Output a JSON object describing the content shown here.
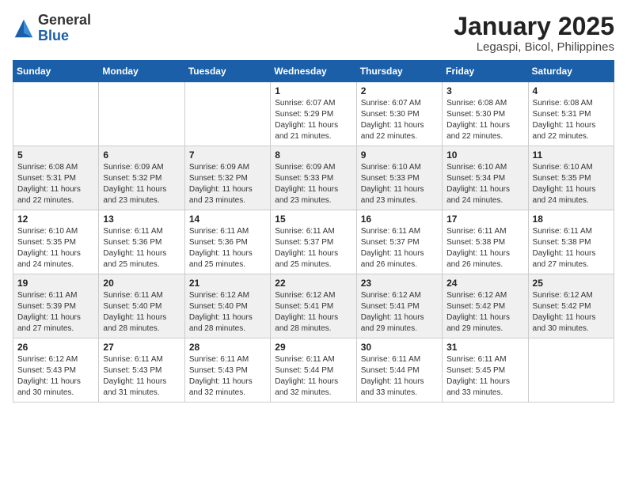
{
  "logo": {
    "text_general": "General",
    "text_blue": "Blue"
  },
  "title": "January 2025",
  "subtitle": "Legaspi, Bicol, Philippines",
  "days_of_week": [
    "Sunday",
    "Monday",
    "Tuesday",
    "Wednesday",
    "Thursday",
    "Friday",
    "Saturday"
  ],
  "weeks": [
    [
      {
        "day": "",
        "sunrise": "",
        "sunset": "",
        "daylight": ""
      },
      {
        "day": "",
        "sunrise": "",
        "sunset": "",
        "daylight": ""
      },
      {
        "day": "",
        "sunrise": "",
        "sunset": "",
        "daylight": ""
      },
      {
        "day": "1",
        "sunrise": "Sunrise: 6:07 AM",
        "sunset": "Sunset: 5:29 PM",
        "daylight": "Daylight: 11 hours and 21 minutes."
      },
      {
        "day": "2",
        "sunrise": "Sunrise: 6:07 AM",
        "sunset": "Sunset: 5:30 PM",
        "daylight": "Daylight: 11 hours and 22 minutes."
      },
      {
        "day": "3",
        "sunrise": "Sunrise: 6:08 AM",
        "sunset": "Sunset: 5:30 PM",
        "daylight": "Daylight: 11 hours and 22 minutes."
      },
      {
        "day": "4",
        "sunrise": "Sunrise: 6:08 AM",
        "sunset": "Sunset: 5:31 PM",
        "daylight": "Daylight: 11 hours and 22 minutes."
      }
    ],
    [
      {
        "day": "5",
        "sunrise": "Sunrise: 6:08 AM",
        "sunset": "Sunset: 5:31 PM",
        "daylight": "Daylight: 11 hours and 22 minutes."
      },
      {
        "day": "6",
        "sunrise": "Sunrise: 6:09 AM",
        "sunset": "Sunset: 5:32 PM",
        "daylight": "Daylight: 11 hours and 23 minutes."
      },
      {
        "day": "7",
        "sunrise": "Sunrise: 6:09 AM",
        "sunset": "Sunset: 5:32 PM",
        "daylight": "Daylight: 11 hours and 23 minutes."
      },
      {
        "day": "8",
        "sunrise": "Sunrise: 6:09 AM",
        "sunset": "Sunset: 5:33 PM",
        "daylight": "Daylight: 11 hours and 23 minutes."
      },
      {
        "day": "9",
        "sunrise": "Sunrise: 6:10 AM",
        "sunset": "Sunset: 5:33 PM",
        "daylight": "Daylight: 11 hours and 23 minutes."
      },
      {
        "day": "10",
        "sunrise": "Sunrise: 6:10 AM",
        "sunset": "Sunset: 5:34 PM",
        "daylight": "Daylight: 11 hours and 24 minutes."
      },
      {
        "day": "11",
        "sunrise": "Sunrise: 6:10 AM",
        "sunset": "Sunset: 5:35 PM",
        "daylight": "Daylight: 11 hours and 24 minutes."
      }
    ],
    [
      {
        "day": "12",
        "sunrise": "Sunrise: 6:10 AM",
        "sunset": "Sunset: 5:35 PM",
        "daylight": "Daylight: 11 hours and 24 minutes."
      },
      {
        "day": "13",
        "sunrise": "Sunrise: 6:11 AM",
        "sunset": "Sunset: 5:36 PM",
        "daylight": "Daylight: 11 hours and 25 minutes."
      },
      {
        "day": "14",
        "sunrise": "Sunrise: 6:11 AM",
        "sunset": "Sunset: 5:36 PM",
        "daylight": "Daylight: 11 hours and 25 minutes."
      },
      {
        "day": "15",
        "sunrise": "Sunrise: 6:11 AM",
        "sunset": "Sunset: 5:37 PM",
        "daylight": "Daylight: 11 hours and 25 minutes."
      },
      {
        "day": "16",
        "sunrise": "Sunrise: 6:11 AM",
        "sunset": "Sunset: 5:37 PM",
        "daylight": "Daylight: 11 hours and 26 minutes."
      },
      {
        "day": "17",
        "sunrise": "Sunrise: 6:11 AM",
        "sunset": "Sunset: 5:38 PM",
        "daylight": "Daylight: 11 hours and 26 minutes."
      },
      {
        "day": "18",
        "sunrise": "Sunrise: 6:11 AM",
        "sunset": "Sunset: 5:38 PM",
        "daylight": "Daylight: 11 hours and 27 minutes."
      }
    ],
    [
      {
        "day": "19",
        "sunrise": "Sunrise: 6:11 AM",
        "sunset": "Sunset: 5:39 PM",
        "daylight": "Daylight: 11 hours and 27 minutes."
      },
      {
        "day": "20",
        "sunrise": "Sunrise: 6:11 AM",
        "sunset": "Sunset: 5:40 PM",
        "daylight": "Daylight: 11 hours and 28 minutes."
      },
      {
        "day": "21",
        "sunrise": "Sunrise: 6:12 AM",
        "sunset": "Sunset: 5:40 PM",
        "daylight": "Daylight: 11 hours and 28 minutes."
      },
      {
        "day": "22",
        "sunrise": "Sunrise: 6:12 AM",
        "sunset": "Sunset: 5:41 PM",
        "daylight": "Daylight: 11 hours and 28 minutes."
      },
      {
        "day": "23",
        "sunrise": "Sunrise: 6:12 AM",
        "sunset": "Sunset: 5:41 PM",
        "daylight": "Daylight: 11 hours and 29 minutes."
      },
      {
        "day": "24",
        "sunrise": "Sunrise: 6:12 AM",
        "sunset": "Sunset: 5:42 PM",
        "daylight": "Daylight: 11 hours and 29 minutes."
      },
      {
        "day": "25",
        "sunrise": "Sunrise: 6:12 AM",
        "sunset": "Sunset: 5:42 PM",
        "daylight": "Daylight: 11 hours and 30 minutes."
      }
    ],
    [
      {
        "day": "26",
        "sunrise": "Sunrise: 6:12 AM",
        "sunset": "Sunset: 5:43 PM",
        "daylight": "Daylight: 11 hours and 30 minutes."
      },
      {
        "day": "27",
        "sunrise": "Sunrise: 6:11 AM",
        "sunset": "Sunset: 5:43 PM",
        "daylight": "Daylight: 11 hours and 31 minutes."
      },
      {
        "day": "28",
        "sunrise": "Sunrise: 6:11 AM",
        "sunset": "Sunset: 5:43 PM",
        "daylight": "Daylight: 11 hours and 32 minutes."
      },
      {
        "day": "29",
        "sunrise": "Sunrise: 6:11 AM",
        "sunset": "Sunset: 5:44 PM",
        "daylight": "Daylight: 11 hours and 32 minutes."
      },
      {
        "day": "30",
        "sunrise": "Sunrise: 6:11 AM",
        "sunset": "Sunset: 5:44 PM",
        "daylight": "Daylight: 11 hours and 33 minutes."
      },
      {
        "day": "31",
        "sunrise": "Sunrise: 6:11 AM",
        "sunset": "Sunset: 5:45 PM",
        "daylight": "Daylight: 11 hours and 33 minutes."
      },
      {
        "day": "",
        "sunrise": "",
        "sunset": "",
        "daylight": ""
      }
    ]
  ]
}
